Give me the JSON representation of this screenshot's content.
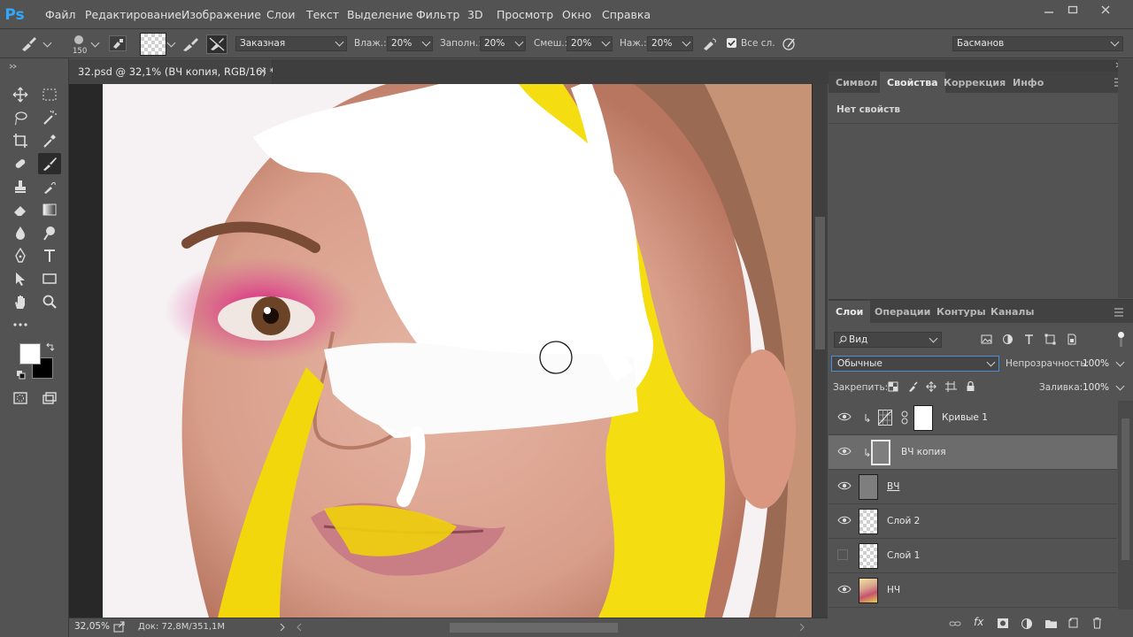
{
  "app": {
    "logo": "Ps"
  },
  "menu": [
    "Файл",
    "Редактирование",
    "Изображение",
    "Слои",
    "Текст",
    "Выделение",
    "Фильтр",
    "3D",
    "Просмотр",
    "Окно",
    "Справка"
  ],
  "options": {
    "brush_size": "150",
    "mode": "Заказная",
    "wet_label": "Влаж.:",
    "wet_value": "20%",
    "load_label": "Заполн.:",
    "load_value": "20%",
    "mix_label": "Смеш.:",
    "mix_value": "20%",
    "flow_label": "Наж.:",
    "flow_value": "20%",
    "sample_all_label": "Все сл.",
    "workspace": "Басманов"
  },
  "document": {
    "tab_title": "32.psd @ 32,1% (ВЧ копия, RGB/16) *",
    "close": "×"
  },
  "status": {
    "zoom": "32,05%",
    "doc_info": "Док: 72,8M/351,1M"
  },
  "properties_panel": {
    "tabs": [
      "Символ",
      "Свойства",
      "Коррекция",
      "Инфо"
    ],
    "active_tab": "Свойства",
    "empty_text": "Нет свойств"
  },
  "layers_panel": {
    "tabs": [
      "Слои",
      "Операции",
      "Контуры",
      "Каналы"
    ],
    "filter_label": "Вид",
    "blend_mode": "Обычные",
    "opacity_label": "Непрозрачность:",
    "opacity_value": "100%",
    "lock_label": "Закрепить:",
    "fill_label": "Заливка:",
    "fill_value": "100%",
    "layers": [
      {
        "name": "Кривые 1",
        "visible": true
      },
      {
        "name": "ВЧ копия",
        "visible": true,
        "selected": true
      },
      {
        "name": "ВЧ",
        "visible": true
      },
      {
        "name": "Слой 2",
        "visible": true
      },
      {
        "name": "Слой 1",
        "visible": false
      },
      {
        "name": "НЧ",
        "visible": true
      }
    ]
  },
  "colors": {
    "accent": "#31a8ff",
    "selected_row": "#6c6c6c"
  }
}
